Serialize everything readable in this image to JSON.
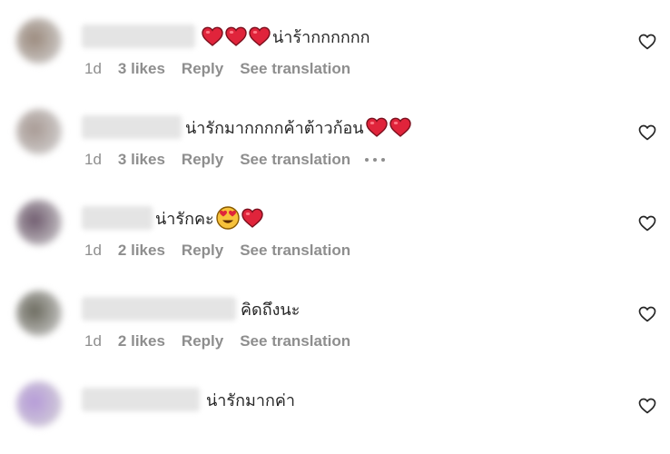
{
  "comments": [
    {
      "text": "น่าร้ากกกกกก",
      "leading_emojis": [
        "heart",
        "heart",
        "heart"
      ],
      "trailing_emojis": [],
      "time": "1d",
      "likes": "3 likes",
      "reply": "Reply",
      "see_translation": "See translation",
      "show_more": false,
      "avatar_color": "#9b8a7d",
      "name_width": 125
    },
    {
      "text": "น่ารักมากกกกค้าต้าวก้อน",
      "leading_emojis": [],
      "trailing_emojis": [
        "heart",
        "heart"
      ],
      "time": "1d",
      "likes": "3 likes",
      "reply": "Reply",
      "see_translation": "See translation",
      "show_more": true,
      "avatar_color": "#a89a94",
      "name_width": 110
    },
    {
      "text": "น่ารักคะ",
      "leading_emojis": [],
      "trailing_emojis": [
        "heart-eyes",
        "heart"
      ],
      "time": "1d",
      "likes": "2 likes",
      "reply": "Reply",
      "see_translation": "See translation",
      "show_more": false,
      "avatar_color": "#6f5b6e",
      "name_width": 78
    },
    {
      "text": "คิดถึงนะ",
      "leading_emojis": [],
      "trailing_emojis": [],
      "time": "1d",
      "likes": "2 likes",
      "reply": "Reply",
      "see_translation": "See translation",
      "show_more": false,
      "avatar_color": "#6b6a5e",
      "name_width": 170
    },
    {
      "text": "น่ารักมากค่า",
      "leading_emojis": [],
      "trailing_emojis": [],
      "time": "",
      "likes": "",
      "reply": "",
      "see_translation": "",
      "show_more": false,
      "avatar_color": "#b59ad8",
      "name_width": 130
    }
  ],
  "colors": {
    "text": "#262626",
    "meta": "#8e8e8e",
    "heart": "#e0243b",
    "background": "#ffffff"
  },
  "icons": {
    "like": "heart-outline-icon",
    "more": "more-horizontal-icon",
    "heart_emoji": "red-heart-emoji",
    "heart_eyes_emoji": "smiling-face-with-heart-eyes-emoji"
  }
}
